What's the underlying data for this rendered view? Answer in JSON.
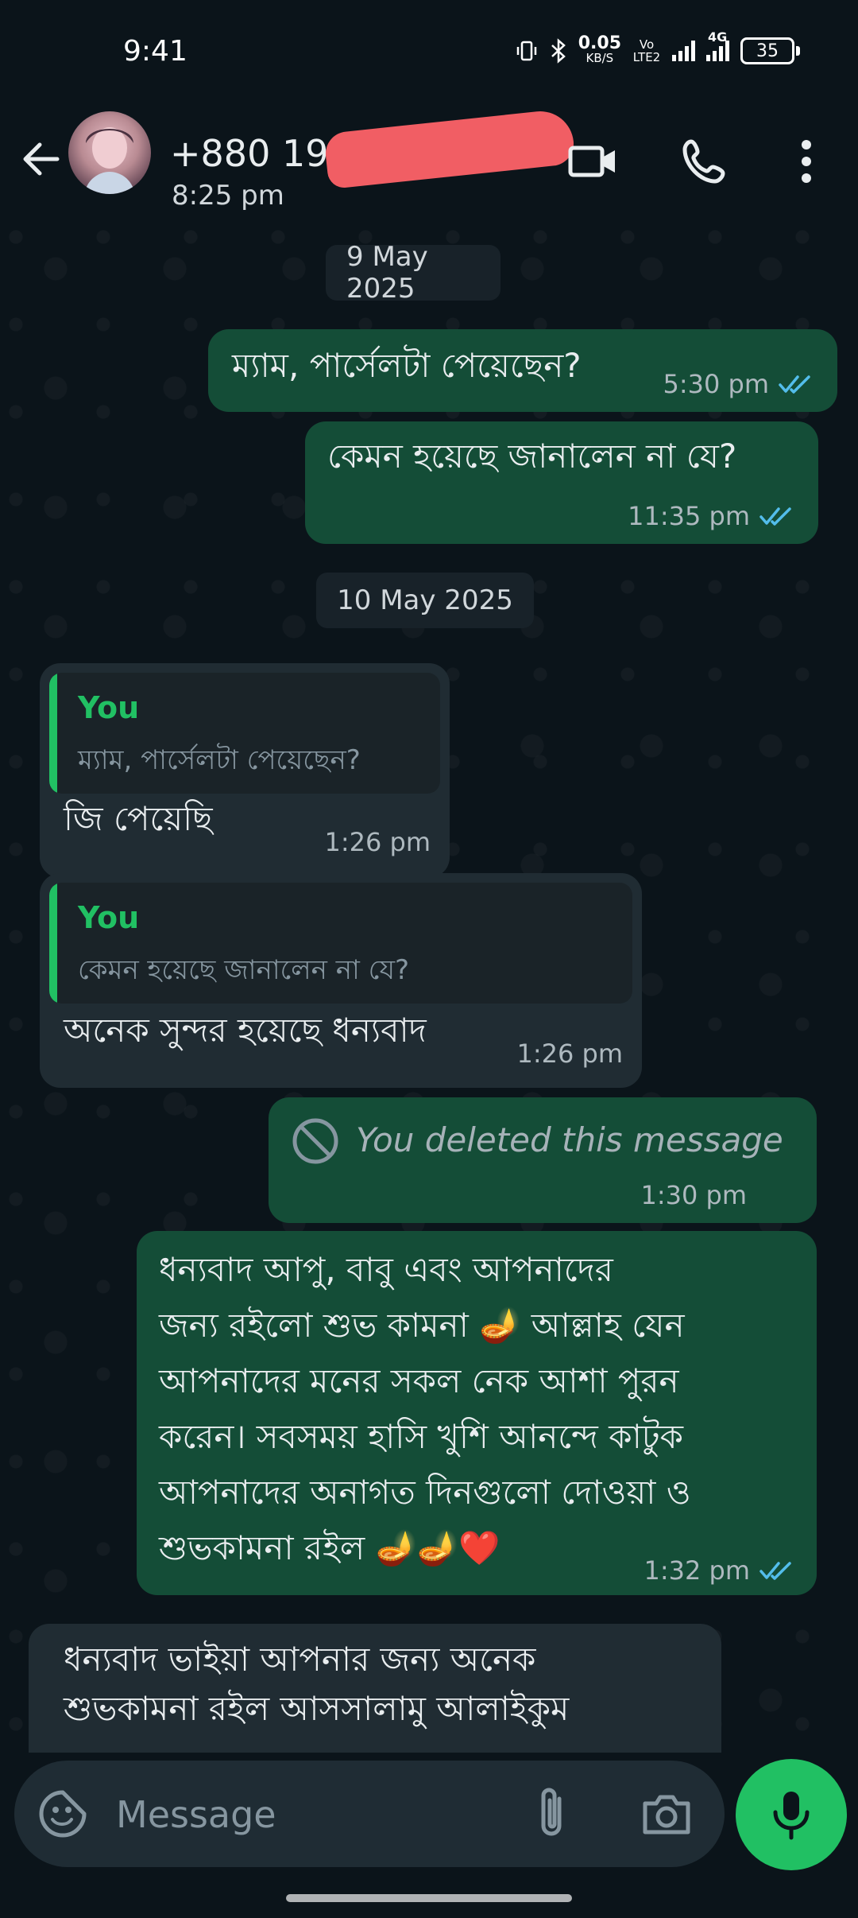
{
  "status_bar": {
    "time": "9:41",
    "net_speed_value": "0.05",
    "net_speed_unit": "KB/S",
    "volte": "Vo LTE2",
    "network": "4G",
    "battery": "35"
  },
  "header": {
    "contact_name": "+880 199",
    "last_seen": "8:25 pm",
    "icons": [
      "back-arrow-icon",
      "video-call-icon",
      "phone-icon",
      "more-vert-icon"
    ]
  },
  "chat": {
    "date_1": "9 May 2025",
    "date_2": "10 May 2025",
    "msg1": {
      "text": "ম্যাম, পার্সেলটা পেয়েছেন?",
      "time": "5:30 pm"
    },
    "msg2": {
      "text": "কেমন হয়েছে জানালেন না যে?",
      "time": "11:35 pm"
    },
    "msg3": {
      "quote_author": "You",
      "quote_text": "ম্যাম, পার্সেলটা পেয়েছেন?",
      "text": "জি পেয়েছি",
      "time": "1:26 pm"
    },
    "msg4": {
      "quote_author": "You",
      "quote_text": "কেমন হয়েছে জানালেন না যে?",
      "text": "অনেক সুন্দর হয়েছে ধন্যবাদ",
      "time": "1:26 pm"
    },
    "msg5": {
      "text": "You deleted this message",
      "time": "1:30 pm"
    },
    "msg6": {
      "lines": [
        "ধন্যবাদ আপু, বাবু এবং আপনাদের",
        "জন্য রইলো শুভ কামনা 🪔 আল্লাহ যেন",
        "আপনাদের মনের সকল নেক আশা পুরন",
        "করেন। সবসময় হাসি খুশি আনন্দে কাটুক",
        "আপনাদের অনাগত দিনগুলো দোওয়া ও",
        "শুভকামনা রইল 🪔🪔❤️"
      ],
      "time": "1:32 pm"
    },
    "msg7": {
      "lines": [
        "ধন্যবাদ ভাইয়া আপনার জন্য অনেক",
        "শুভকামনা রইল আসসালামু আলাইকুম"
      ]
    }
  },
  "composer": {
    "placeholder": "Message",
    "icons": [
      "emoji-icon",
      "attach-icon",
      "camera-icon",
      "mic-icon"
    ]
  },
  "colors": {
    "background": "#0b141a",
    "outgoing_bubble": "#144d37",
    "incoming_bubble": "#202c33",
    "accent_green": "#21c063",
    "read_tick": "#53bdeb"
  }
}
